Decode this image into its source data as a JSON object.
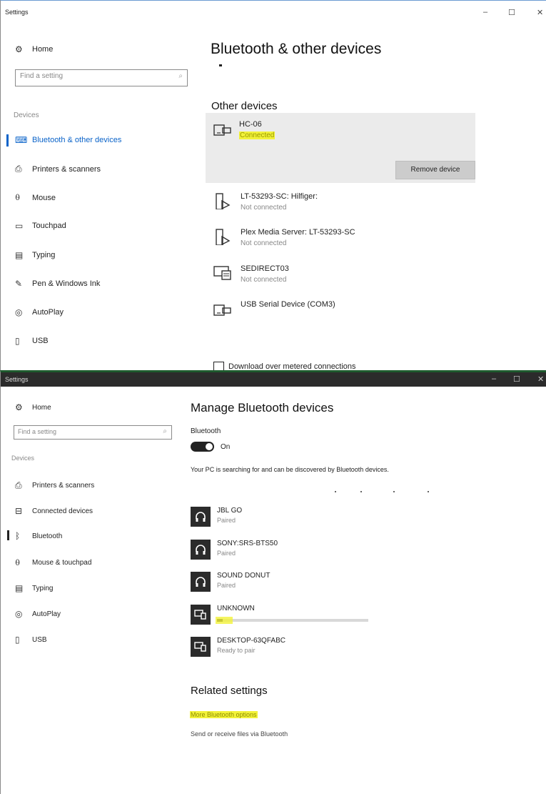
{
  "window1": {
    "title": "Settings",
    "controls": {
      "minimize": "–",
      "maximize": "☐",
      "close": "✕"
    },
    "sidebar": {
      "home_label": "Home",
      "search_placeholder": "Find a setting",
      "section_label": "Devices",
      "items": [
        {
          "label": "Bluetooth & other devices",
          "icon": "bluetooth-devices-icon",
          "selected": true
        },
        {
          "label": "Printers & scanners",
          "icon": "printer-icon"
        },
        {
          "label": "Mouse",
          "icon": "mouse-icon"
        },
        {
          "label": "Touchpad",
          "icon": "touchpad-icon"
        },
        {
          "label": "Typing",
          "icon": "keyboard-icon"
        },
        {
          "label": "Pen & Windows Ink",
          "icon": "pen-icon"
        },
        {
          "label": "AutoPlay",
          "icon": "autoplay-icon"
        },
        {
          "label": "USB",
          "icon": "usb-icon"
        }
      ]
    },
    "main": {
      "page_title": "Bluetooth & other devices",
      "section_title": "Other devices",
      "devices": [
        {
          "name": "HC-06",
          "status": "Connected",
          "icon": "device-icon",
          "selected": true
        },
        {
          "name": "LT-53293-SC: Hilfiger:",
          "status": "Not connected",
          "icon": "media-device-icon"
        },
        {
          "name": "Plex Media Server: LT-53293-SC",
          "status": "Not connected",
          "icon": "media-device-icon"
        },
        {
          "name": "SEDIRECT03",
          "status": "Not connected",
          "icon": "display-device-icon"
        },
        {
          "name": "USB Serial Device (COM3)",
          "status": "",
          "icon": "device-icon"
        }
      ],
      "remove_button": "Remove device",
      "metered_checkbox_label": "Download over metered connections"
    }
  },
  "window2": {
    "title": "Settings",
    "controls": {
      "minimize": "–",
      "maximize": "☐",
      "close": "✕"
    },
    "sidebar": {
      "home_label": "Home",
      "search_placeholder": "Find a setting",
      "section_label": "Devices",
      "items": [
        {
          "label": "Printers & scanners",
          "icon": "printer-icon"
        },
        {
          "label": "Connected devices",
          "icon": "connected-devices-icon"
        },
        {
          "label": "Bluetooth",
          "icon": "bluetooth-icon",
          "selected": true
        },
        {
          "label": "Mouse & touchpad",
          "icon": "mouse-icon"
        },
        {
          "label": "Typing",
          "icon": "keyboard-icon"
        },
        {
          "label": "AutoPlay",
          "icon": "autoplay-icon"
        },
        {
          "label": "USB",
          "icon": "usb-icon"
        }
      ]
    },
    "main": {
      "page_title": "Manage Bluetooth devices",
      "bluetooth_label": "Bluetooth",
      "toggle_state": "On",
      "searching_text": "Your PC is searching for and can be discovered by Bluetooth devices.",
      "devices": [
        {
          "name": "JBL GO",
          "status": "Paired",
          "icon": "headphones-icon"
        },
        {
          "name": "SONY:SRS-BTS50",
          "status": "Paired",
          "icon": "headphones-icon"
        },
        {
          "name": "SOUND DONUT",
          "status": "Paired",
          "icon": "headphones-icon"
        },
        {
          "name": "UNKNOWN",
          "status": "",
          "icon": "device-pair-icon",
          "progress": 0.04
        },
        {
          "name": "DESKTOP-63QFABC",
          "status": "Ready to pair",
          "icon": "device-pair-icon"
        }
      ],
      "related_title": "Related settings",
      "related_links": [
        {
          "label": "More Bluetooth options",
          "highlighted": true
        },
        {
          "label": "Send or receive files via Bluetooth"
        }
      ]
    }
  }
}
